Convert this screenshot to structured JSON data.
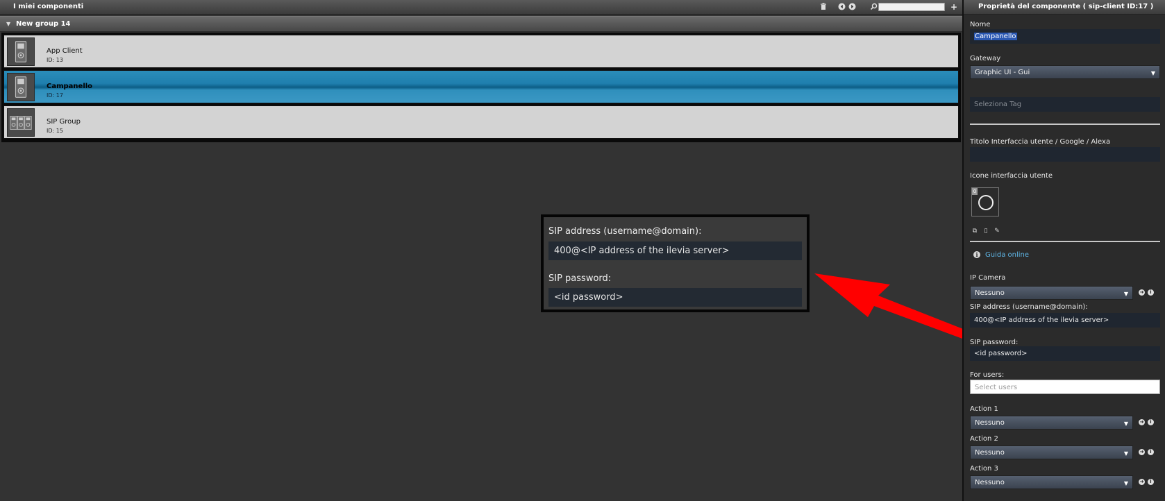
{
  "left": {
    "title": "I miei componenti",
    "group_name": "New group 14",
    "items": [
      {
        "name": "App Client",
        "id": "ID: 13",
        "selected": false
      },
      {
        "name": "Campanello",
        "id": "ID: 17",
        "selected": true
      },
      {
        "name": "SIP Group",
        "id": "ID: 15",
        "selected": false
      }
    ],
    "toolbar_icons": [
      "trash-icon",
      "arrow-left-icon",
      "arrow-right-icon",
      "search-icon",
      "plus-icon"
    ],
    "search_value": ""
  },
  "zoom": {
    "sip_address_label": "SIP address (username@domain):",
    "sip_address_value": "400@<IP address of the ilevia server>",
    "sip_password_label": "SIP password:",
    "sip_password_value": "<id password>"
  },
  "right": {
    "title": "Proprietà del componente ( sip-client ID:17 )",
    "nome_label": "Nome",
    "nome_value": "Campanello",
    "gateway_label": "Gateway",
    "gateway_value": "Graphic UI - Gui",
    "tag_placeholder": "Seleziona Tag",
    "titolo_label": "Titolo Interfaccia utente / Google / Alexa",
    "titolo_value": "",
    "icone_label": "Icone interfaccia utente",
    "icon_badge": "0",
    "guida_link": "Guida online",
    "ip_camera_label": "IP Camera",
    "ip_camera_value": "Nessuno",
    "sip_address_label": "SIP address (username@domain):",
    "sip_address_value": "400@<IP address of the ilevia server>",
    "sip_password_label": "SIP password:",
    "sip_password_value": "<id password>",
    "for_users_label": "For users:",
    "for_users_placeholder": "Select users",
    "action1_label": "Action 1",
    "action1_value": "Nessuno",
    "action2_label": "Action 2",
    "action2_value": "Nessuno",
    "action3_label": "Action 3",
    "action3_value": "Nessuno"
  },
  "colors": {
    "selected_row": "#1f7fae",
    "link": "#5fb6e6",
    "arrow": "#ff0000",
    "panel_bg": "#2b2b2b"
  }
}
